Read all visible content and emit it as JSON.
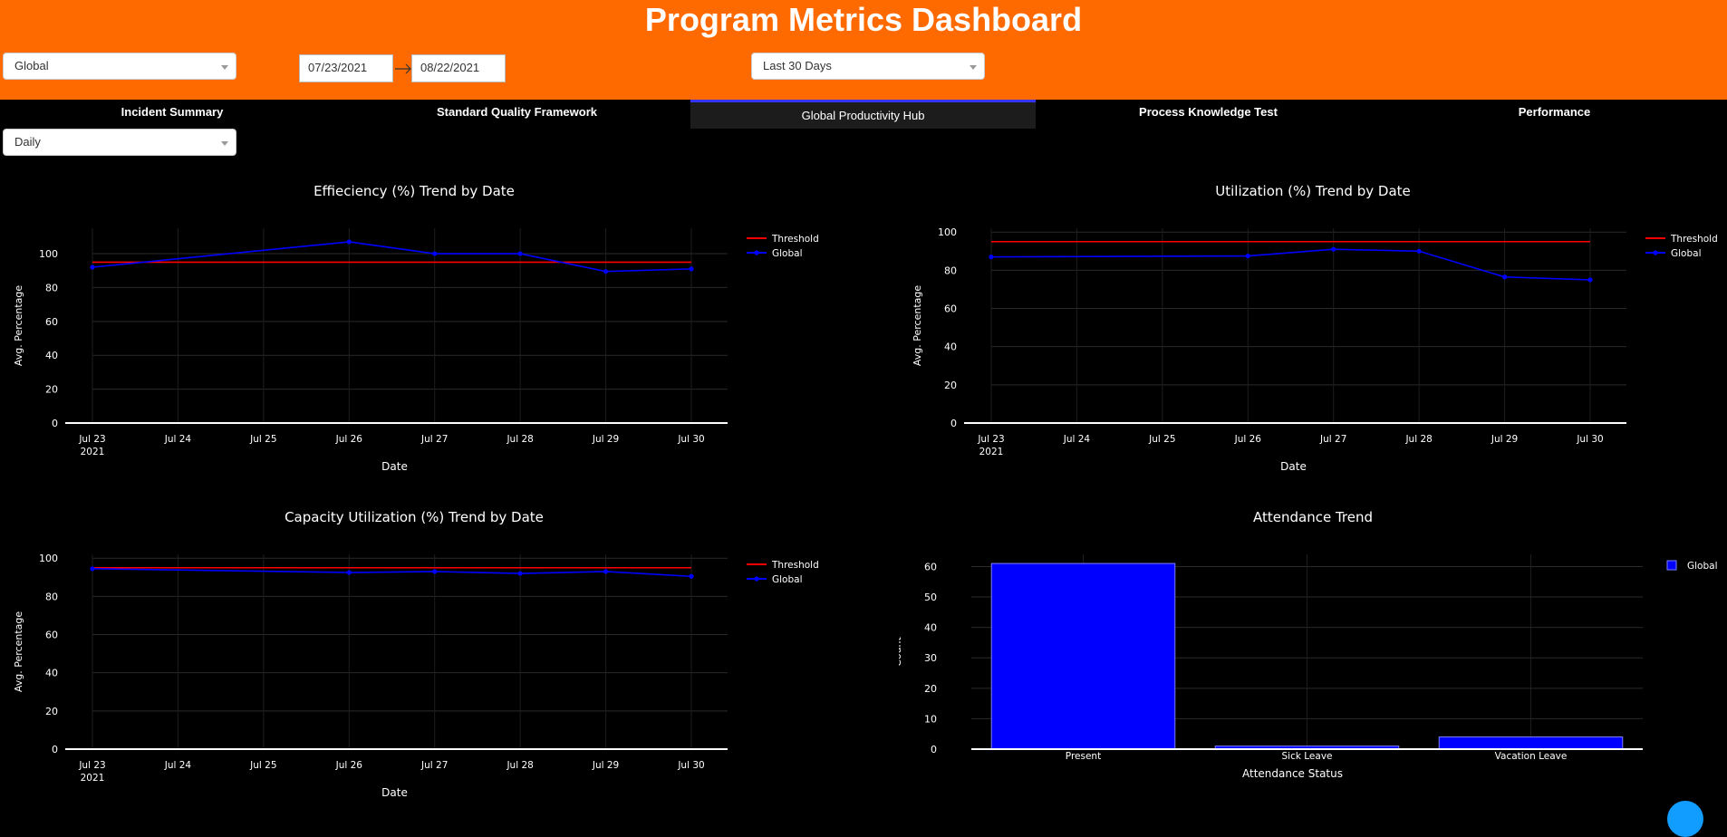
{
  "header": {
    "title": "Program Metrics Dashboard"
  },
  "filters": {
    "region": "Global",
    "start_date": "07/23/2021",
    "end_date": "08/22/2021",
    "period": "Last 30 Days",
    "granularity": "Daily"
  },
  "tabs": [
    {
      "label": "Incident Summary",
      "active": false
    },
    {
      "label": "Standard Quality Framework",
      "active": false
    },
    {
      "label": "Global Productivity Hub",
      "active": true
    },
    {
      "label": "Process Knowledge Test",
      "active": false
    },
    {
      "label": "Performance",
      "active": false
    }
  ],
  "colors": {
    "header": "#ff6a00",
    "threshold": "#ff0000",
    "series": "#0000ff",
    "active_tab_border": "#3535ff"
  },
  "chart_data": [
    {
      "id": "efficiency",
      "type": "line",
      "title": "Effieciency (%) Trend by Date",
      "xlabel": "Date",
      "ylabel": "Avg. Percentage",
      "x": [
        "Jul 23",
        "Jul 24",
        "Jul 25",
        "Jul 26",
        "Jul 27",
        "Jul 28",
        "Jul 29",
        "Jul 30"
      ],
      "x_year_label": "2021",
      "yticks": [
        0,
        20,
        40,
        60,
        80,
        100
      ],
      "ylim": [
        0,
        115
      ],
      "legend": "top-right",
      "series": [
        {
          "name": "Threshold",
          "color": "#ff0000",
          "markers": false,
          "values": [
            95,
            95,
            95,
            95,
            95,
            95,
            95,
            95
          ]
        },
        {
          "name": "Global",
          "color": "#0000ff",
          "markers": true,
          "x_index": [
            0,
            3,
            4,
            5,
            6,
            7
          ],
          "values": [
            92,
            107,
            100,
            100,
            89.5,
            91
          ]
        }
      ]
    },
    {
      "id": "utilization",
      "type": "line",
      "title": "Utilization (%) Trend by Date",
      "xlabel": "Date",
      "ylabel": "Avg. Percentage",
      "x": [
        "Jul 23",
        "Jul 24",
        "Jul 25",
        "Jul 26",
        "Jul 27",
        "Jul 28",
        "Jul 29",
        "Jul 30"
      ],
      "x_year_label": "2021",
      "yticks": [
        0,
        20,
        40,
        60,
        80,
        100
      ],
      "ylim": [
        0,
        102
      ],
      "legend": "top-right",
      "series": [
        {
          "name": "Threshold",
          "color": "#ff0000",
          "markers": false,
          "values": [
            95,
            95,
            95,
            95,
            95,
            95,
            95,
            95
          ]
        },
        {
          "name": "Global",
          "color": "#0000ff",
          "markers": true,
          "x_index": [
            0,
            3,
            4,
            5,
            6,
            7
          ],
          "values": [
            87,
            87.5,
            91,
            90,
            76.5,
            75
          ]
        }
      ]
    },
    {
      "id": "capacity",
      "type": "line",
      "title": "Capacity Utilization (%) Trend by Date",
      "xlabel": "Date",
      "ylabel": "Avg. Percentage",
      "x": [
        "Jul 23",
        "Jul 24",
        "Jul 25",
        "Jul 26",
        "Jul 27",
        "Jul 28",
        "Jul 29",
        "Jul 30"
      ],
      "x_year_label": "2021",
      "yticks": [
        0,
        20,
        40,
        60,
        80,
        100
      ],
      "ylim": [
        0,
        102
      ],
      "legend": "top-right",
      "series": [
        {
          "name": "Threshold",
          "color": "#ff0000",
          "markers": false,
          "values": [
            95,
            95,
            95,
            95,
            95,
            95,
            95,
            95
          ]
        },
        {
          "name": "Global",
          "color": "#0000ff",
          "markers": true,
          "x_index": [
            0,
            3,
            4,
            5,
            6,
            7
          ],
          "values": [
            94.5,
            92.5,
            93,
            92,
            93,
            90.5
          ]
        }
      ]
    },
    {
      "id": "attendance",
      "type": "bar",
      "title": "Attendance Trend",
      "xlabel": "Attendance Status",
      "ylabel": "Count",
      "categories": [
        "Present",
        "Sick Leave",
        "Vacation Leave"
      ],
      "yticks": [
        0,
        10,
        20,
        30,
        40,
        50,
        60
      ],
      "ylim": [
        0,
        64
      ],
      "legend": "top-right",
      "series": [
        {
          "name": "Global",
          "color": "#0000ff",
          "values": [
            61,
            1,
            4
          ]
        }
      ]
    }
  ]
}
